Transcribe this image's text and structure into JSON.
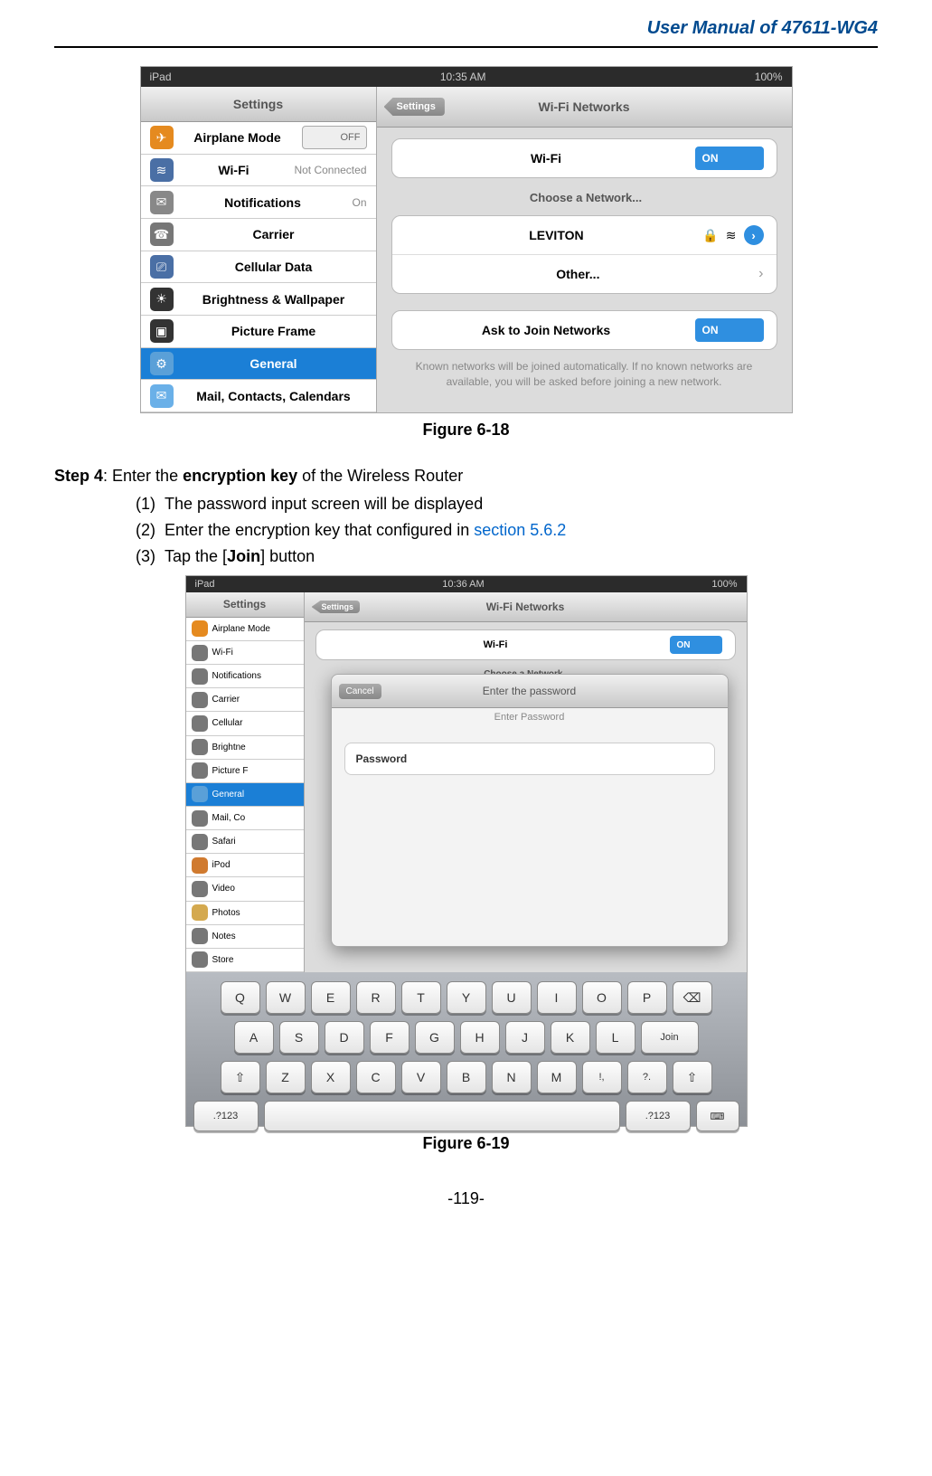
{
  "header": {
    "title": "User Manual of 47611-WG4"
  },
  "fig1": {
    "caption": "Figure 6-18",
    "status": {
      "left": "iPad",
      "center": "10:35 AM",
      "right": "100%"
    },
    "sidebar": {
      "title": "Settings",
      "items": [
        {
          "label": "Airplane Mode",
          "value": "OFF",
          "icon": "✈"
        },
        {
          "label": "Wi-Fi",
          "value": "Not Connected",
          "icon": "≋"
        },
        {
          "label": "Notifications",
          "value": "On",
          "icon": "✉"
        },
        {
          "label": "Carrier",
          "value": "",
          "icon": "☎"
        },
        {
          "label": "Cellular Data",
          "value": "",
          "icon": "⎚"
        },
        {
          "label": "Brightness & Wallpaper",
          "value": "",
          "icon": "☀"
        },
        {
          "label": "Picture Frame",
          "value": "",
          "icon": "▣"
        },
        {
          "label": "General",
          "value": "",
          "icon": "⚙"
        },
        {
          "label": "Mail, Contacts, Calendars",
          "value": "",
          "icon": "✉"
        }
      ]
    },
    "pane": {
      "back": "Settings",
      "title": "Wi-Fi Networks",
      "wifi_label": "Wi-Fi",
      "wifi_toggle": "ON",
      "choose_label": "Choose a Network...",
      "network_name": "LEVITON",
      "other_label": "Other...",
      "ask_label": "Ask to Join Networks",
      "ask_toggle": "ON",
      "note": "Known networks will be joined automatically. If no known networks are available, you will be asked before joining a new network."
    }
  },
  "step": {
    "step_label": "Step 4",
    "step_text": ": Enter the ",
    "step_bold": "encryption key",
    "step_text2": " of the Wireless Router",
    "items": {
      "num1": "(1)",
      "text1": "The password input screen will be displayed",
      "num2": "(2)",
      "text2a": "Enter the encryption key that configured in ",
      "text2b": "section 5.6.2",
      "num3": "(3)",
      "text3a": "Tap the [",
      "text3b": "Join",
      "text3c": "] button"
    }
  },
  "fig2": {
    "caption": "Figure 6-19",
    "status": {
      "left": "iPad",
      "center": "10:36 AM",
      "right": "100%"
    },
    "sidebar": {
      "title": "Settings",
      "items": [
        {
          "label": "Airplane Mode"
        },
        {
          "label": "Wi-Fi"
        },
        {
          "label": "Notifications"
        },
        {
          "label": "Carrier"
        },
        {
          "label": "Cellular"
        },
        {
          "label": "Brightne"
        },
        {
          "label": "Picture F"
        },
        {
          "label": "General"
        },
        {
          "label": "Mail, Co"
        },
        {
          "label": "Safari"
        },
        {
          "label": "iPod"
        },
        {
          "label": "Video"
        },
        {
          "label": "Photos"
        },
        {
          "label": "Notes"
        },
        {
          "label": "Store"
        }
      ]
    },
    "pane": {
      "back": "Settings",
      "title": "Wi-Fi Networks",
      "wifi_label": "Wi-Fi",
      "wifi_toggle": "ON",
      "choose_label": "Choose a Network..."
    },
    "modal": {
      "title": "Enter the password",
      "cancel": "Cancel",
      "placeholder": "Enter Password",
      "field_label": "Password"
    },
    "keyboard": {
      "row1": [
        "Q",
        "W",
        "E",
        "R",
        "T",
        "Y",
        "U",
        "I",
        "O",
        "P",
        "⌫"
      ],
      "row2": [
        "A",
        "S",
        "D",
        "F",
        "G",
        "H",
        "J",
        "K",
        "L",
        "Join"
      ],
      "row3": [
        "⇧",
        "Z",
        "X",
        "C",
        "V",
        "B",
        "N",
        "M",
        "!,",
        "?.",
        "⇧"
      ],
      "row4": [
        ".?123",
        "",
        ".?123",
        "⌨"
      ]
    }
  },
  "footer": {
    "page": "-119-"
  }
}
